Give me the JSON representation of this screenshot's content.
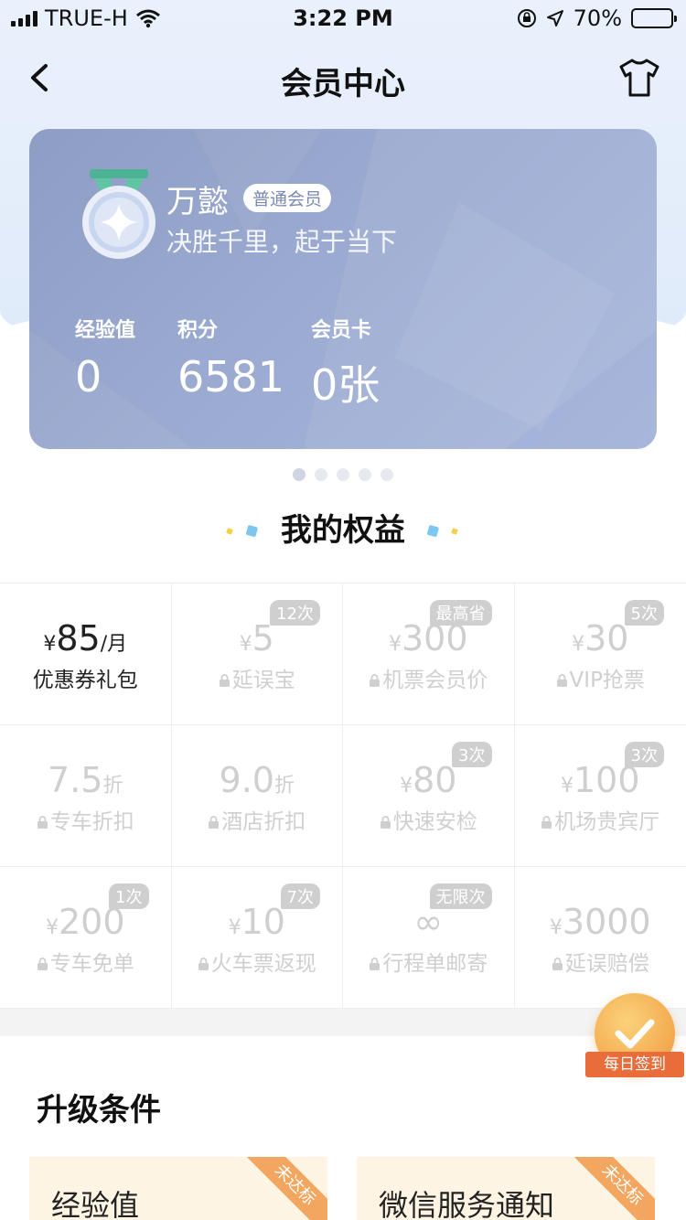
{
  "status_bar": {
    "carrier": "TRUE-H",
    "time": "3:22 PM",
    "battery_text": "70%",
    "battery_level": 0.7
  },
  "nav": {
    "title": "会员中心"
  },
  "card": {
    "user_name": "万懿",
    "level": "普通会员",
    "slogan": "决胜千里，起于当下",
    "stats": [
      {
        "label": "经验值",
        "value": "0"
      },
      {
        "label": "积分",
        "value": "6581"
      },
      {
        "label": "会员卡",
        "value": "0张"
      }
    ],
    "page_indicator": {
      "total": 5,
      "active": 1
    }
  },
  "benefits": {
    "title": "我的权益",
    "items": [
      {
        "symbol": "¥",
        "value": "85",
        "unit": "/月",
        "label": "优惠券礼包",
        "tag": "",
        "locked": false
      },
      {
        "symbol": "¥",
        "value": "5",
        "unit": "",
        "label": "延误宝",
        "tag": "12次",
        "locked": true
      },
      {
        "symbol": "¥",
        "value": "300",
        "unit": "",
        "label": "机票会员价",
        "tag": "最高省",
        "locked": true
      },
      {
        "symbol": "¥",
        "value": "30",
        "unit": "",
        "label": "VIP抢票",
        "tag": "5次",
        "locked": true
      },
      {
        "symbol": "",
        "value": "7.5",
        "unit": "折",
        "label": "专车折扣",
        "tag": "",
        "locked": true
      },
      {
        "symbol": "",
        "value": "9.0",
        "unit": "折",
        "label": "酒店折扣",
        "tag": "",
        "locked": true
      },
      {
        "symbol": "¥",
        "value": "80",
        "unit": "",
        "label": "快速安检",
        "tag": "3次",
        "locked": true
      },
      {
        "symbol": "¥",
        "value": "100",
        "unit": "",
        "label": "机场贵宾厅",
        "tag": "3次",
        "locked": true
      },
      {
        "symbol": "¥",
        "value": "200",
        "unit": "",
        "label": "专车免单",
        "tag": "1次",
        "locked": true
      },
      {
        "symbol": "¥",
        "value": "10",
        "unit": "",
        "label": "火车票返现",
        "tag": "7次",
        "locked": true
      },
      {
        "symbol": "",
        "value": "∞",
        "unit": "",
        "label": "行程单邮寄",
        "tag": "无限次",
        "locked": true
      },
      {
        "symbol": "¥",
        "value": "3000",
        "unit": "",
        "label": "延误赔偿",
        "tag": "",
        "locked": true
      }
    ]
  },
  "checkin": {
    "label": "每日签到"
  },
  "upgrade": {
    "title": "升级条件",
    "conditions": [
      {
        "label": "经验值",
        "status": "未达标"
      },
      {
        "label": "微信服务通知",
        "status": "未达标"
      }
    ]
  },
  "colors": {
    "card": "#9aaad0",
    "accent_orange": "#f2a65f",
    "checkin_red": "#e86d3b",
    "disabled": "#cfcfcf"
  }
}
